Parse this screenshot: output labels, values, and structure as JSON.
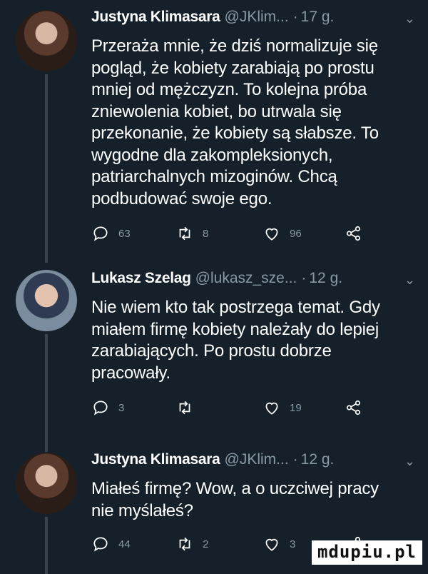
{
  "tweets": [
    {
      "name": "Justyna Klimasara",
      "handle": "@JKlim...",
      "time": "17 g.",
      "text": "Przeraża mnie, że dziś normalizuje się pogląd, że kobiety zarabiają po prostu mniej od mężczyzn. To kolejna próba zniewolenia kobiet, bo utrwala się przekonanie, że kobiety są słabsze. To wygodne dla zakompleksionych, patriarchalnych mizoginów. Chcą podbudować swoje ego.",
      "replies": "63",
      "retweets": "8",
      "likes": "96"
    },
    {
      "name": "Lukasz Szelag",
      "handle": "@lukasz_sze...",
      "time": "12 g.",
      "text": "Nie wiem kto tak postrzega temat. Gdy miałem firmę kobiety należały do lepiej zarabiających. Po prostu dobrze pracowały.",
      "replies": "3",
      "retweets": "",
      "likes": "19"
    },
    {
      "name": "Justyna Klimasara",
      "handle": "@JKlim...",
      "time": "12 g.",
      "text": "Miałeś firmę? Wow, a o uczciwej pracy nie myślałeś?",
      "replies": "44",
      "retweets": "2",
      "likes": "3"
    }
  ],
  "separator": "·",
  "watermark": "mdupiu.pl",
  "icons": {
    "reply": "reply-icon",
    "retweet": "retweet-icon",
    "like": "heart-icon",
    "share": "share-icon",
    "menu": "chevron-down-icon"
  },
  "colors": {
    "background": "#15202b",
    "text": "#ffffff",
    "secondary": "#8899a6",
    "thread_line": "#38444d"
  }
}
